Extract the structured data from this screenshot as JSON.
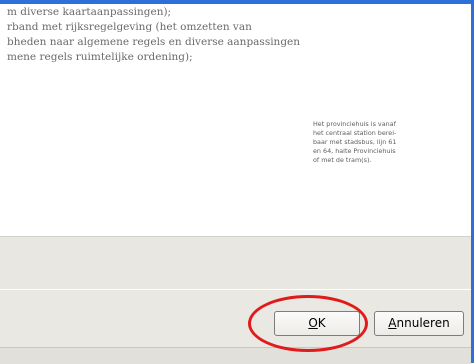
{
  "document": {
    "lines": [
      "",
      "m diverse kaartaanpassingen);",
      "rband met rijksregelgeving (het omzetten van",
      "bheden naar algemene regels en diverse aanpassingen",
      "mene regels ruimtelijke ordening);"
    ],
    "side_note": [
      "Het provinciehuis is vanaf",
      "het centraal station berei-",
      "baar met stadsbus, lijn 61",
      "en 64, halte Provinciehuis",
      "of met de tram(s)."
    ]
  },
  "buttons": {
    "ok": {
      "mnemonic": "O",
      "rest": "K"
    },
    "cancel": {
      "mnemonic": "A",
      "rest": "nnuleren"
    }
  },
  "colors": {
    "frame": "#2f6fd8",
    "annotation": "#e01b1b",
    "panel": "#e9e7e2"
  }
}
